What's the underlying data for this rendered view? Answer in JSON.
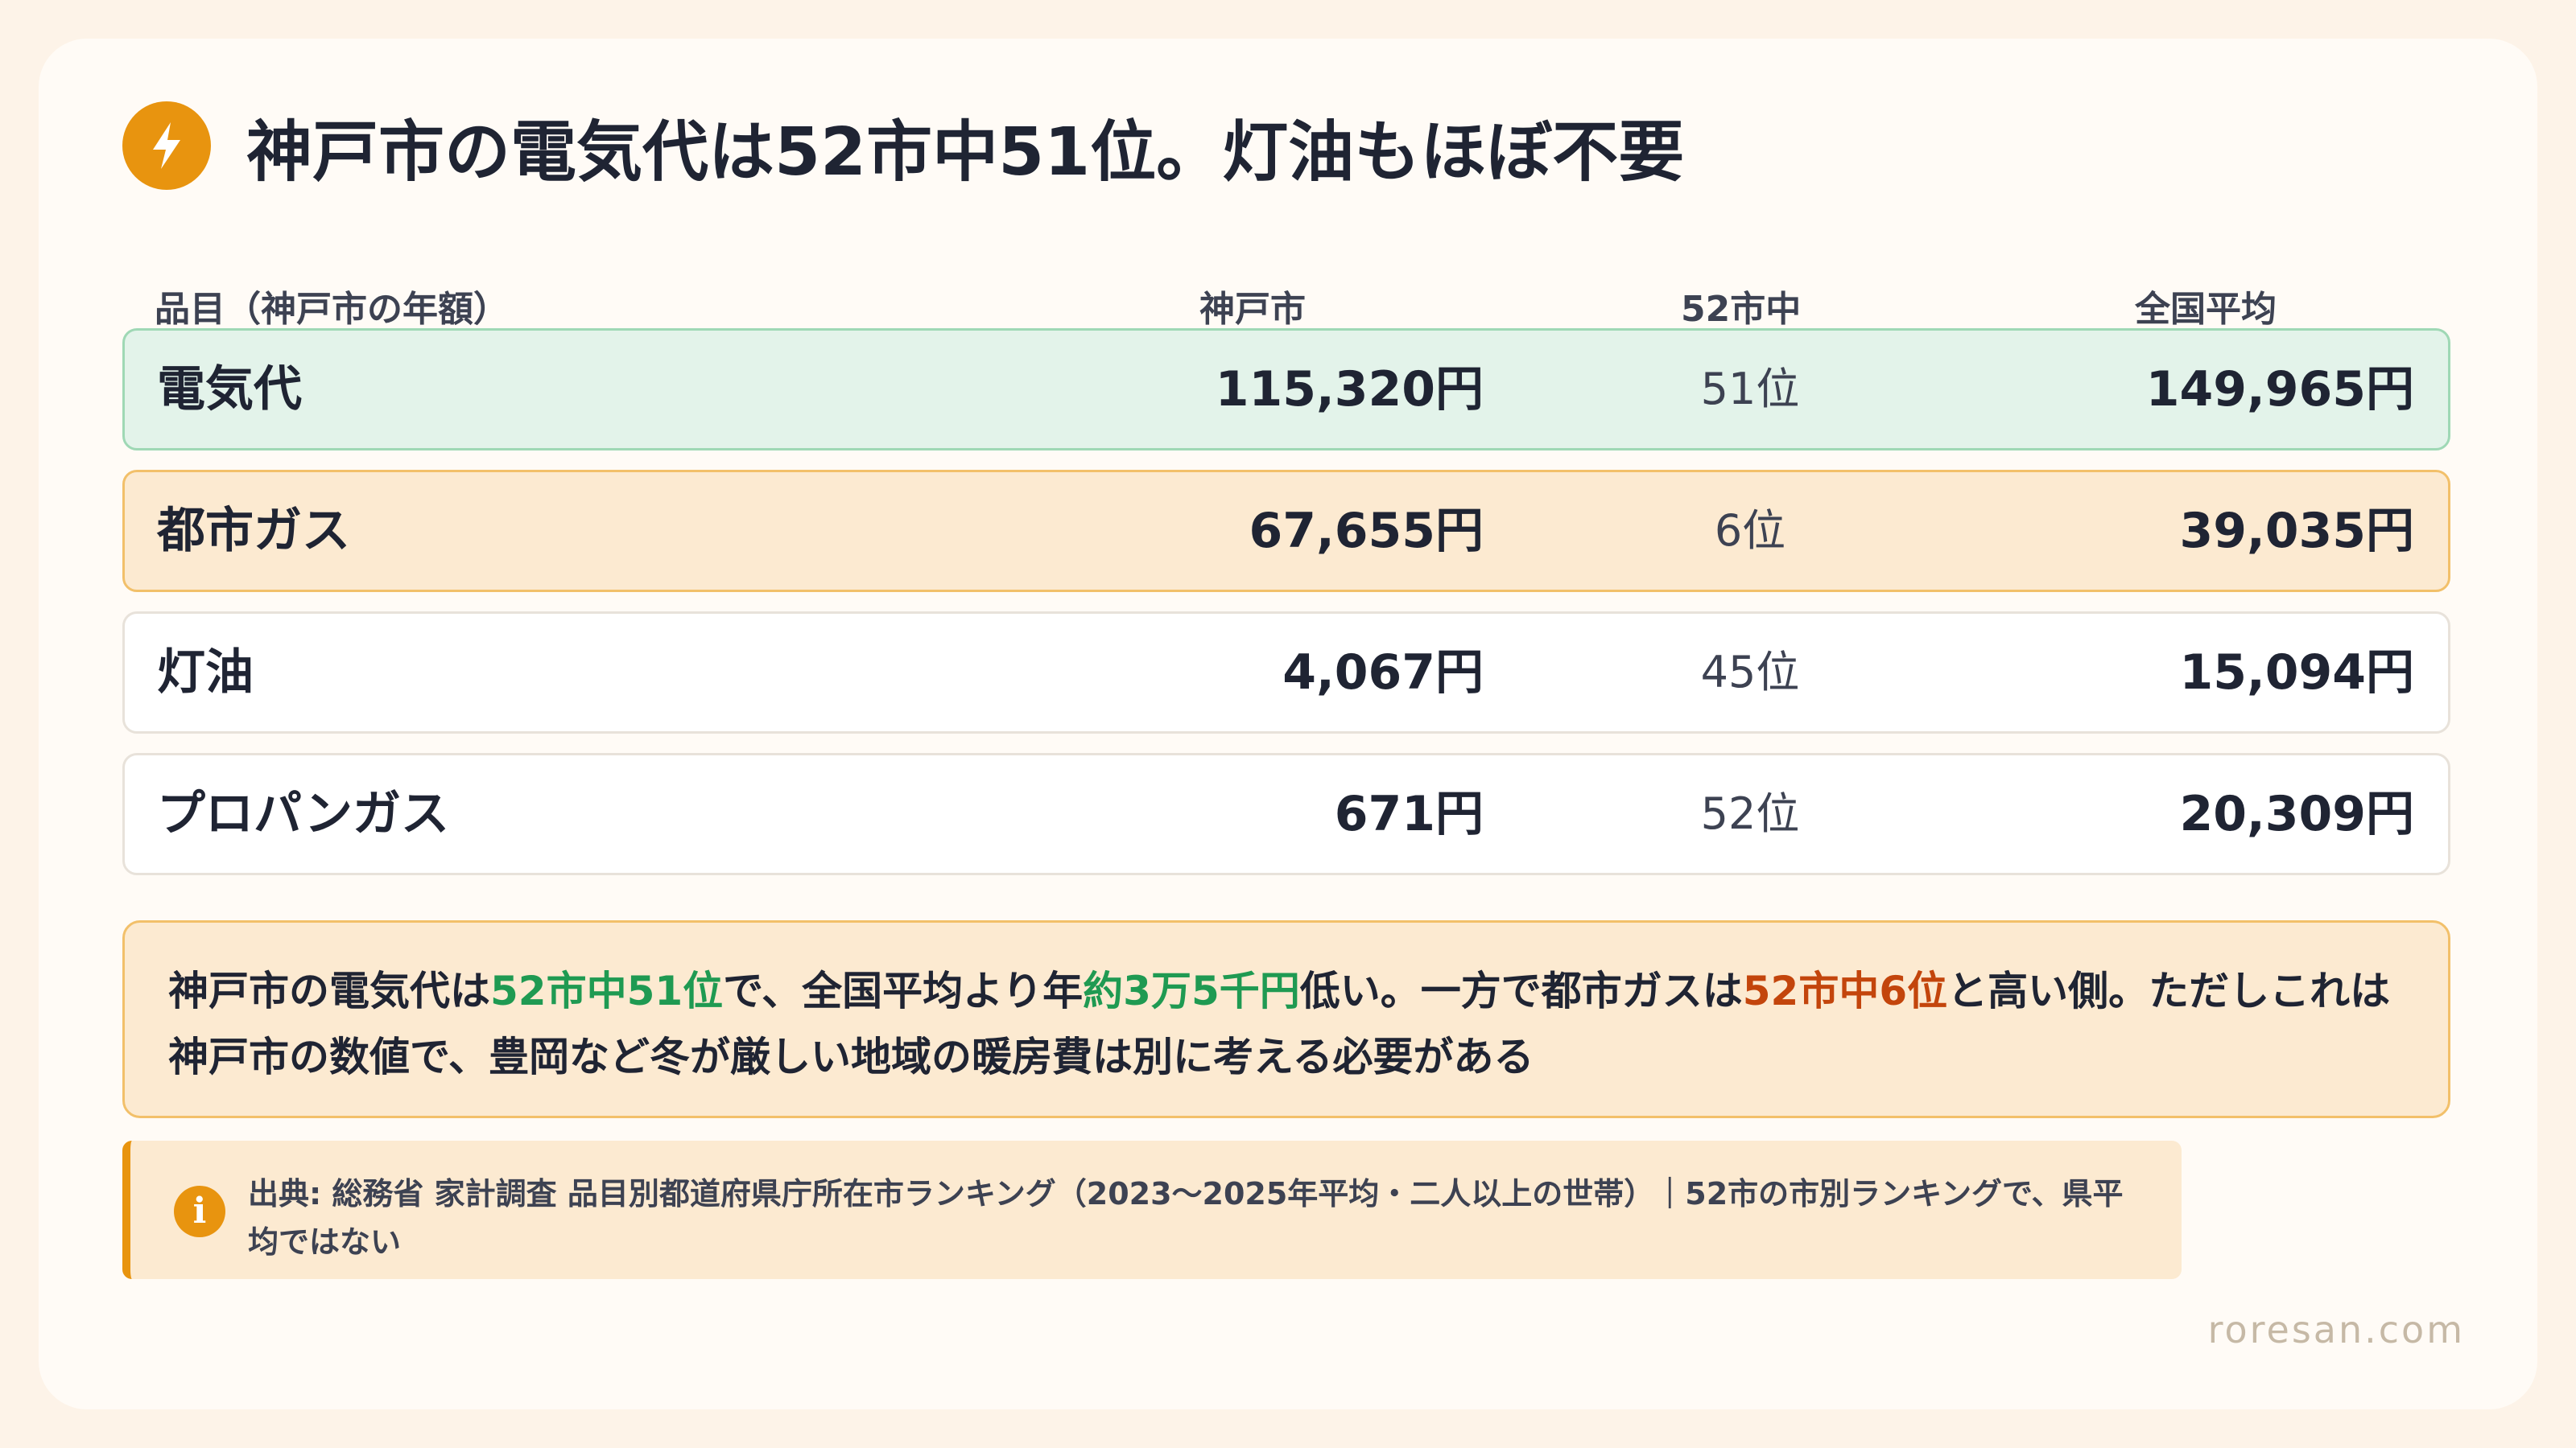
{
  "header": {
    "title": "神戸市の電気代は52市中51位。灯油もほぼ不要",
    "icon": "lightning-icon",
    "accent_color": "#e8940f"
  },
  "table": {
    "columns": [
      "品目（神戸市の年額）",
      "神戸市",
      "52市中",
      "全国平均"
    ],
    "rows": [
      {
        "item": "電気代",
        "kobe": "115,320円",
        "rank": "51位",
        "average": "149,965円",
        "highlight": "green"
      },
      {
        "item": "都市ガス",
        "kobe": "67,655円",
        "rank": "6位",
        "average": "39,035円",
        "highlight": "orange"
      },
      {
        "item": "灯油",
        "kobe": "4,067円",
        "rank": "45位",
        "average": "15,094円",
        "highlight": "none"
      },
      {
        "item": "プロパンガス",
        "kobe": "671円",
        "rank": "52位",
        "average": "20,309円",
        "highlight": "none"
      }
    ]
  },
  "note": {
    "p1": "神戸市の電気代は",
    "h1": "52市中51位",
    "p2": "で、全国平均より年",
    "h2": "約3万5千円",
    "p3": "低い。一方で都市ガスは",
    "h3": "52市中6位",
    "p4": "と高い側。ただしこれは神戸市の数値で、豊岡など冬が厳しい地域の暖房費は別に考える必要がある",
    "green_color": "#1f9a52",
    "red_color": "#c3450c"
  },
  "source": {
    "icon": "info-icon",
    "icon_glyph": "i",
    "text": "出典: 総務省 家計調査 品目別都道府県庁所在市ランキング（2023〜2025年平均・二人以上の世帯）｜52市の市別ランキングで、県平均ではない"
  },
  "footer": {
    "brand": "roresan.com"
  }
}
